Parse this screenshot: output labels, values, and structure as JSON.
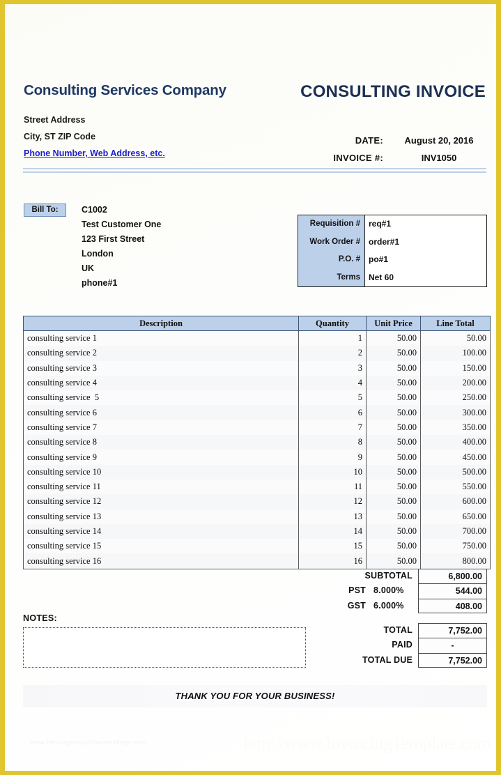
{
  "header": {
    "company_name": "Consulting Services Company",
    "invoice_title": "CONSULTING INVOICE",
    "address_line1": "Street Address",
    "address_line2": "City, ST  ZIP Code",
    "contact_link": "Phone Number, Web Address, etc.",
    "date_label": "DATE:",
    "date_value": "August 20, 2016",
    "invoice_no_label": "INVOICE #:",
    "invoice_no_value": "INV1050"
  },
  "bill_to": {
    "label": "Bill To:",
    "lines": [
      "C1002",
      "Test Customer One",
      "123 First Street",
      "London",
      "UK",
      "phone#1"
    ]
  },
  "reference_box": {
    "labels": [
      "Requisition #",
      "Work Order #",
      "P.O. #",
      "Terms"
    ],
    "values": [
      "req#1",
      "order#1",
      "po#1",
      "Net 60"
    ]
  },
  "items_table": {
    "columns": [
      "Description",
      "Quantity",
      "Unit Price",
      "Line Total"
    ],
    "rows": [
      {
        "description": "consulting service 1",
        "quantity": "1",
        "unit_price": "50.00",
        "line_total": "50.00"
      },
      {
        "description": "consulting service 2",
        "quantity": "2",
        "unit_price": "50.00",
        "line_total": "100.00"
      },
      {
        "description": "consulting service 3",
        "quantity": "3",
        "unit_price": "50.00",
        "line_total": "150.00"
      },
      {
        "description": "consulting service 4",
        "quantity": "4",
        "unit_price": "50.00",
        "line_total": "200.00"
      },
      {
        "description": "consulting service  5",
        "quantity": "5",
        "unit_price": "50.00",
        "line_total": "250.00"
      },
      {
        "description": "consulting service 6",
        "quantity": "6",
        "unit_price": "50.00",
        "line_total": "300.00"
      },
      {
        "description": "consulting service 7",
        "quantity": "7",
        "unit_price": "50.00",
        "line_total": "350.00"
      },
      {
        "description": "consulting service 8",
        "quantity": "8",
        "unit_price": "50.00",
        "line_total": "400.00"
      },
      {
        "description": "consulting service 9",
        "quantity": "9",
        "unit_price": "50.00",
        "line_total": "450.00"
      },
      {
        "description": "consulting service 10",
        "quantity": "10",
        "unit_price": "50.00",
        "line_total": "500.00"
      },
      {
        "description": "consulting service 11",
        "quantity": "11",
        "unit_price": "50.00",
        "line_total": "550.00"
      },
      {
        "description": "consulting service 12",
        "quantity": "12",
        "unit_price": "50.00",
        "line_total": "600.00"
      },
      {
        "description": "consulting service 13",
        "quantity": "13",
        "unit_price": "50.00",
        "line_total": "650.00"
      },
      {
        "description": "consulting service 14",
        "quantity": "14",
        "unit_price": "50.00",
        "line_total": "700.00"
      },
      {
        "description": "consulting service 15",
        "quantity": "15",
        "unit_price": "50.00",
        "line_total": "750.00"
      },
      {
        "description": "consulting service 16",
        "quantity": "16",
        "unit_price": "50.00",
        "line_total": "800.00"
      }
    ]
  },
  "summary_upper": [
    {
      "label": "SUBTOTAL",
      "rate": "",
      "value": "6,800.00"
    },
    {
      "label": "PST",
      "rate": "8.000%",
      "value": "544.00"
    },
    {
      "label": "GST",
      "rate": "6.000%",
      "value": "408.00"
    }
  ],
  "summary_lower": [
    {
      "label": "TOTAL",
      "rate": "",
      "value": "7,752.00"
    },
    {
      "label": "PAID",
      "rate": "",
      "value": "-"
    },
    {
      "label": "TOTAL DUE",
      "rate": "",
      "value": "7,752.00"
    }
  ],
  "notes": {
    "label": "NOTES:",
    "value": ""
  },
  "footer": {
    "thanks": "THANK YOU FOR YOUR BUSINESS!",
    "watermark_left": "www.thecsagency/columncollege.com",
    "watermark_right": "http://www.InvoicingTemplate.com"
  },
  "colors": {
    "frame": "#e0c52f",
    "header_blue": "#bdd0ea",
    "company_navy": "#1f3864",
    "link_blue": "#2020c8"
  }
}
